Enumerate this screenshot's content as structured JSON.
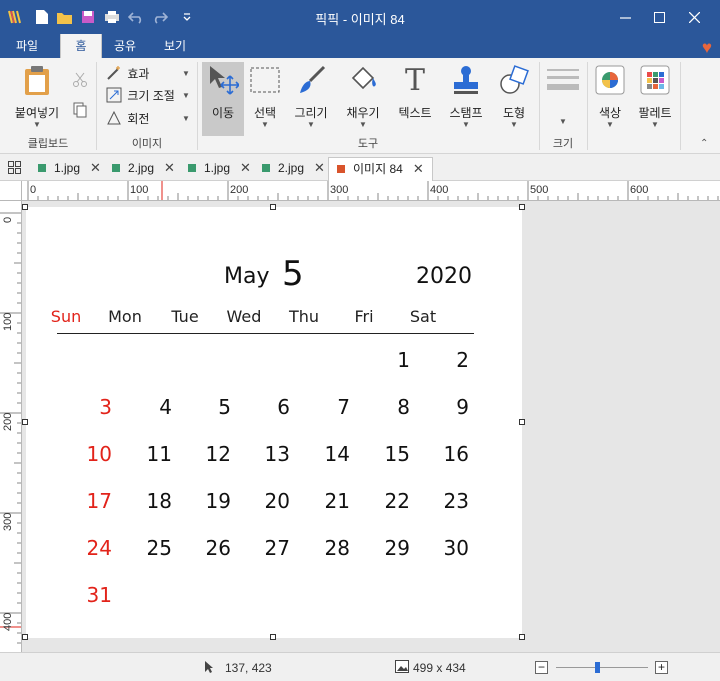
{
  "window": {
    "title": "픽픽 - 이미지 84",
    "controls": [
      "minimize",
      "maximize",
      "close"
    ]
  },
  "quick_access": [
    "app-logo-icon",
    "new-file-icon",
    "open-folder-icon",
    "save-icon",
    "print-icon",
    "undo-icon",
    "redo-icon",
    "customize-icon"
  ],
  "ribbon_tabs": [
    {
      "label": "파일",
      "active": false
    },
    {
      "label": "홈",
      "active": true
    },
    {
      "label": "공유",
      "active": false
    },
    {
      "label": "보기",
      "active": false
    }
  ],
  "ribbon": {
    "clipboard": {
      "paste": "붙여넣기",
      "group_label": "클립보드"
    },
    "image": {
      "effects": "효과",
      "resize": "크기 조절",
      "rotate": "회전",
      "group_label": "이미지"
    },
    "tools": {
      "move": "이동",
      "select": "선택",
      "draw": "그리기",
      "fill": "채우기",
      "text": "텍스트",
      "stamp": "스탬프",
      "shape": "도형",
      "group_label": "도구"
    },
    "size": {
      "group_label": "크기"
    },
    "color": {
      "label": "색상"
    },
    "palette": {
      "label": "팔레트"
    }
  },
  "doc_tabs": [
    {
      "label": "1.jpg",
      "color": "#3a9a6e",
      "active": false
    },
    {
      "label": "2.jpg",
      "color": "#3a9a6e",
      "active": false
    },
    {
      "label": "1.jpg",
      "color": "#3a9a6e",
      "active": false
    },
    {
      "label": "2.jpg",
      "color": "#3a9a6e",
      "active": false
    },
    {
      "label": "이미지 84",
      "color": "#d9542c",
      "active": true
    }
  ],
  "ruler": {
    "horizontal": [
      "0",
      "100",
      "200",
      "300",
      "400",
      "500",
      "600"
    ],
    "vertical": [
      "0",
      "100",
      "200",
      "300",
      "400"
    ]
  },
  "calendar": {
    "month": "May",
    "day": "5",
    "year": "2020",
    "weekdays": [
      "Sun",
      "Mon",
      "Tue",
      "Wed",
      "Thu",
      "Fri",
      "Sat"
    ],
    "weeks": [
      [
        "",
        "",
        "",
        "",
        "",
        "1",
        "2"
      ],
      [
        "3",
        "4",
        "5",
        "6",
        "7",
        "8",
        "9"
      ],
      [
        "10",
        "11",
        "12",
        "13",
        "14",
        "15",
        "16"
      ],
      [
        "17",
        "18",
        "19",
        "20",
        "21",
        "22",
        "23"
      ],
      [
        "24",
        "25",
        "26",
        "27",
        "28",
        "29",
        "30"
      ],
      [
        "31",
        "",
        "",
        "",
        "",
        "",
        ""
      ]
    ],
    "sunday_color": "#e2231a"
  },
  "status": {
    "cursor": "137, 423",
    "image_size": "499 x 434",
    "zoom_fraction": 0.45
  },
  "colors": {
    "accent": "#2b579a",
    "heart": "#e8663c"
  }
}
